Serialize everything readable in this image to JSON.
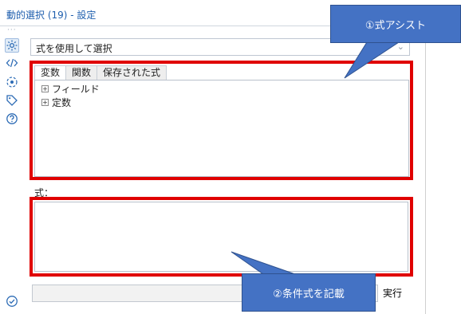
{
  "window": {
    "title": "動的選択 (19) - 設定",
    "dots": "···"
  },
  "sidebar": {
    "icons": [
      "gear-icon",
      "code-icon",
      "radar-icon",
      "tag-icon",
      "help-icon"
    ],
    "bottom_icon": "check-circle-icon"
  },
  "config": {
    "mode_value": "式を使用して選択",
    "tabs": [
      "変数",
      "関数",
      "保存された式"
    ],
    "active_tab": "変数",
    "tree_items": [
      {
        "toggle": "+",
        "label": "フィールド"
      },
      {
        "toggle": "+",
        "label": "定数"
      }
    ],
    "expression_label": "式：",
    "expression_value": "",
    "status_value": "",
    "run_label": "実行"
  },
  "annotations": {
    "assist_label": "①式アシスト",
    "condition_label": "②条件式を記載",
    "highlight_color": "#e00000",
    "callout_color": "#4472c4"
  }
}
